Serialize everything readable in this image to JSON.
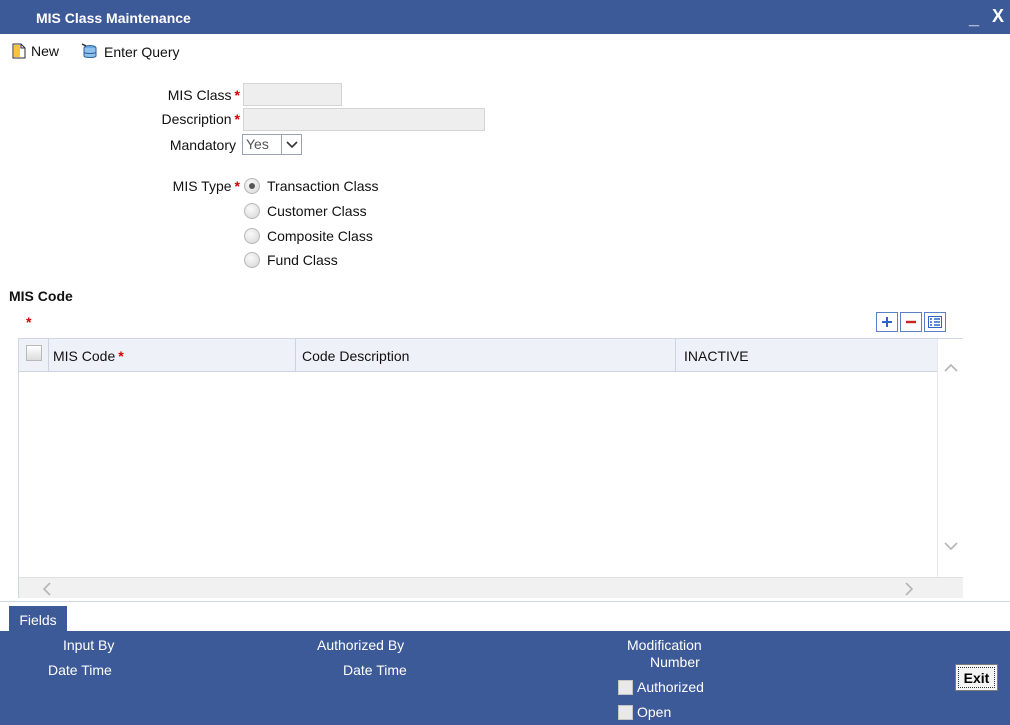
{
  "window": {
    "title": "MIS Class Maintenance",
    "minimize_glyph": "_",
    "close_glyph": "X"
  },
  "toolbar": {
    "new_label": "New",
    "enter_query_label": "Enter Query"
  },
  "form": {
    "mis_class_label": "MIS Class",
    "mis_class_value": "",
    "description_label": "Description",
    "description_value": "",
    "mandatory_label": "Mandatory",
    "mandatory_value": "Yes",
    "required_marker": "*",
    "mis_type_label": "MIS Type",
    "mis_type_options": [
      {
        "label": "Transaction Class",
        "selected": true
      },
      {
        "label": "Customer Class",
        "selected": false
      },
      {
        "label": "Composite Class",
        "selected": false
      },
      {
        "label": "Fund Class",
        "selected": false
      }
    ]
  },
  "mis_code_section": {
    "title": "MIS Code",
    "required_marker": "*",
    "columns": [
      "MIS Code",
      "Code Description",
      "INACTIVE"
    ],
    "rows": []
  },
  "fields_button": "Fields",
  "footer": {
    "input_by": "Input By",
    "date_time_1": "Date Time",
    "authorized_by": "Authorized By",
    "date_time_2": "Date Time",
    "modification": "Modification",
    "number": "Number",
    "authorized_check": "Authorized",
    "open_check": "Open",
    "exit_label": "Exit"
  },
  "colors": {
    "brand_blue": "#3d5a98",
    "required_red": "#d40000"
  }
}
